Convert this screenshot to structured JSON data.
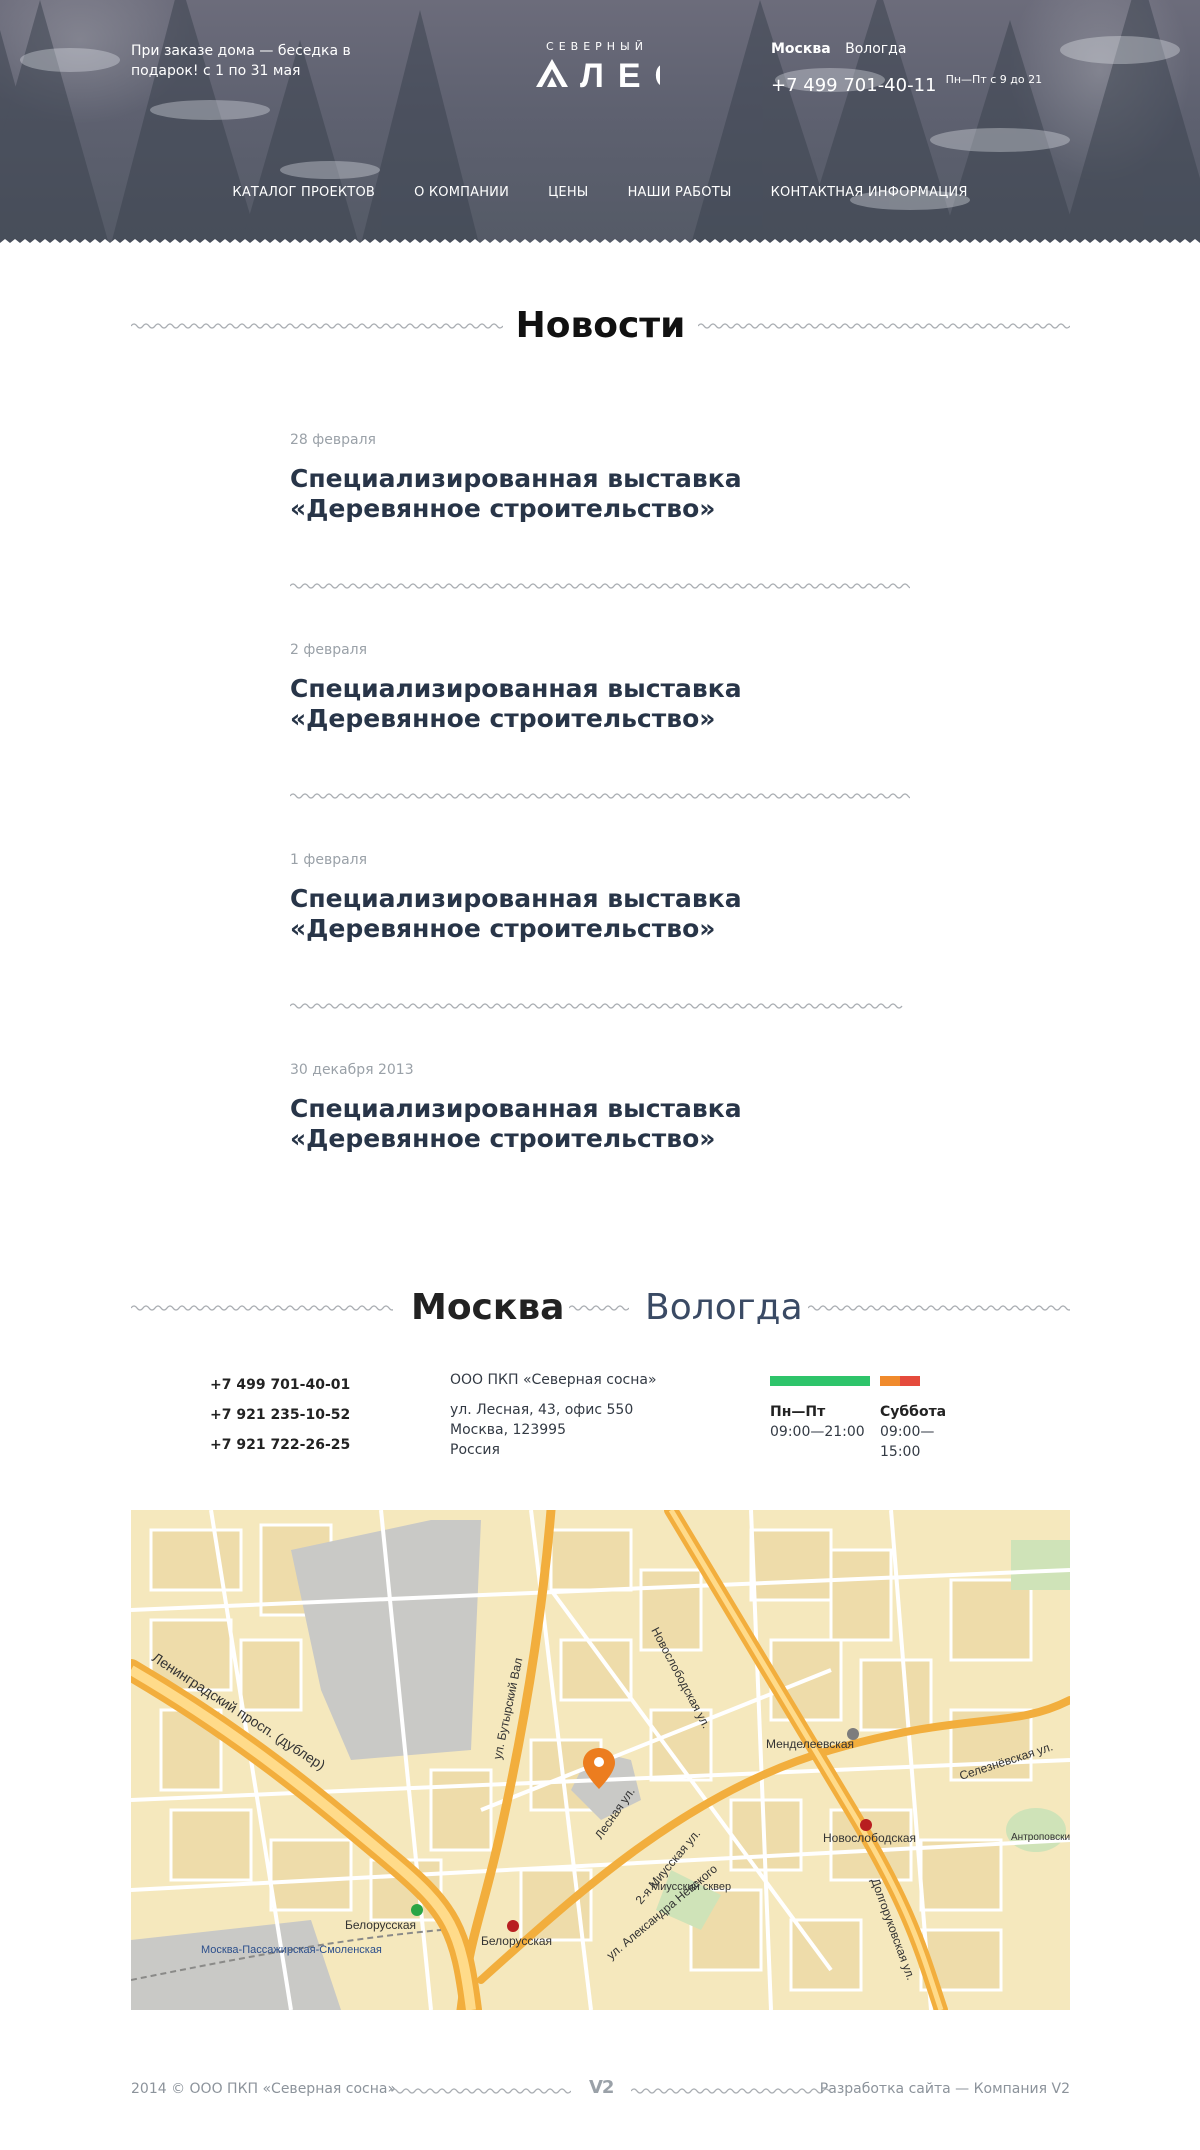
{
  "header": {
    "promo_text": "При заказе дома — беседка в подарок! с 1 по 31 мая",
    "logo": {
      "small_text": "Северный",
      "big_text": "ЛЕС"
    },
    "cities": [
      "Москва",
      "Вологда"
    ],
    "phone": "+7 499 701-40-11",
    "hours": "Пн—Пт с 9 до 21"
  },
  "nav": [
    "Каталог проектов",
    "О компании",
    "Цены",
    "Наши работы",
    "Контактная информация"
  ],
  "news": {
    "heading": "Новости",
    "items": [
      {
        "date": "28 февраля",
        "title": "Специализированная выставка «Деревянное строительство»"
      },
      {
        "date": "2 февраля",
        "title": "Специализированная выставка «Деревянное строительство»"
      },
      {
        "date": "1 февраля",
        "title": "Специализированная выставка «Деревянное строительство»"
      },
      {
        "date": "30 декабря 2013",
        "title": "Специализированная выставка «Деревянное строительство»"
      }
    ]
  },
  "contacts": {
    "city_tabs": [
      "Москва",
      "Вологда"
    ],
    "phones": [
      "+7 499 701-40-01",
      "+7 921 235-10-52",
      "+7 921 722-26-25"
    ],
    "company": "ООО ПКП «Северная сосна»",
    "address_lines": [
      "ул. Лесная, 43, офис 550",
      "Москва, 123995",
      "Россия"
    ],
    "schedule": {
      "weekdays_label": "Пн—Пт",
      "weekdays_hours": "09:00—21:00",
      "saturday_label": "Суббота",
      "saturday_hours": "09:00—15:00",
      "colors": {
        "weekdays": "#2ec46a",
        "saturday_a": "#f08a2c",
        "saturday_b": "#e54b3c"
      }
    }
  },
  "map": {
    "labels": {
      "street_1": "Новослободская ул.",
      "street_2": "Долгоруковская ул.",
      "street_3": "ул. Бутырский Вал",
      "street_4": "Ленинградский просп. (дублер)",
      "street_5": "Лесная ул.",
      "street_6": "2-я Миусская ул.",
      "street_7": "Селезнёвская ул.",
      "street_8": "ул. Александра Невского",
      "metro_1": "Менделеевская",
      "metro_2": "Новослободская",
      "metro_3": "Белорусская",
      "metro_4": "Белорусская",
      "station": "Москва-Пассажирская-Смоленская",
      "park": "Миусский сквер",
      "park_2": "Антроповский сквер"
    }
  },
  "footer": {
    "copyright": "2014 © ООО ПКП «Северная сосна»",
    "developer": "Разработка сайта — Компания V2",
    "dev_logo": "V2"
  }
}
